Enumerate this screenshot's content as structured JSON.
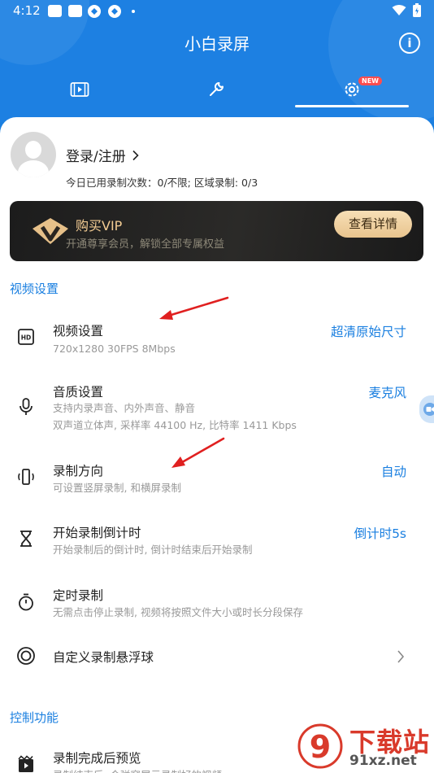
{
  "status_bar": {
    "time": "4:12"
  },
  "header": {
    "title": "小白录屏",
    "new_badge": "NEW"
  },
  "account": {
    "login_label": "登录/注册",
    "quota_text": "今日已用录制次数：0/不限; 区域录制: 0/3"
  },
  "vip": {
    "title": "购买VIP",
    "subtitle": "开通尊享会员，解锁全部专属权益",
    "button": "查看详情"
  },
  "sections": {
    "video": "视频设置",
    "control": "控制功能"
  },
  "settings": [
    {
      "title": "视频设置",
      "subs": [
        "720x1280  30FPS  8Mbps"
      ],
      "value": "超清原始尺寸",
      "icon": "hd-icon"
    },
    {
      "title": "音质设置",
      "subs": [
        "支持内录声音、内外声音、静音",
        "双声道立体声, 采样率 44100 Hz, 比特率 1411 Kbps"
      ],
      "value": "麦克风",
      "icon": "microphone-icon"
    },
    {
      "title": "录制方向",
      "subs": [
        "可设置竖屏录制, 和横屏录制"
      ],
      "value": "自动",
      "icon": "screen-rotation-icon"
    },
    {
      "title": "开始录制倒计时",
      "subs": [
        "开始录制后的倒计时, 倒计时结束后开始录制"
      ],
      "value": "倒计时5s",
      "icon": "hourglass-icon"
    },
    {
      "title": "定时录制",
      "subs": [
        "无需点击停止录制, 视频将按照文件大小或时长分段保存"
      ],
      "value": "",
      "icon": "timer-icon"
    },
    {
      "title": "自定义录制悬浮球",
      "subs": [],
      "value": "",
      "icon": "floating-ball-icon"
    }
  ],
  "control_items": [
    {
      "title": "录制完成后预览",
      "subs": [
        "录制结束后, 会弹窗展示录制好的视频"
      ],
      "icon": "play-preview-icon"
    }
  ],
  "watermark": {
    "text": "下载站",
    "url": "91xz.net",
    "logo": "9"
  },
  "colors": {
    "primary": "#1a7fe0",
    "vip_gold": "#f3cc93",
    "annotation_arrow": "#e02020"
  }
}
